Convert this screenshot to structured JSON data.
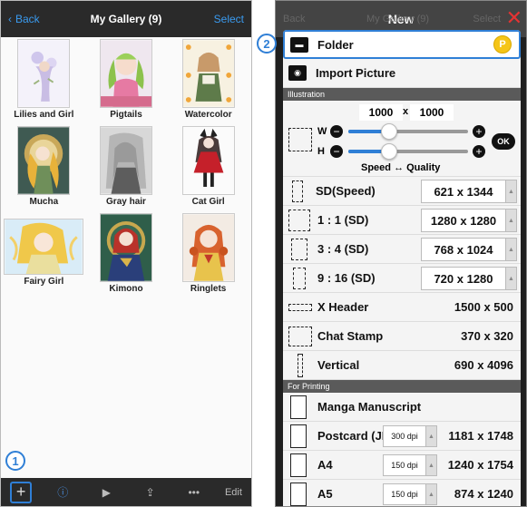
{
  "left": {
    "nav": {
      "back": "Back",
      "title": "My Gallery (9)",
      "select": "Select"
    },
    "items": [
      {
        "caption": "Lilies and Girl"
      },
      {
        "caption": "Pigtails"
      },
      {
        "caption": "Watercolor"
      },
      {
        "caption": "Mucha"
      },
      {
        "caption": "Gray hair"
      },
      {
        "caption": "Cat Girl"
      },
      {
        "caption": "Fairy Girl"
      },
      {
        "caption": "Kimono"
      },
      {
        "caption": "Ringlets"
      }
    ],
    "toolbar": {
      "plus": "+",
      "info": "ⓘ",
      "play": "▶",
      "share": "⇪",
      "more": "•••",
      "edit": "Edit"
    },
    "step_badge": "1"
  },
  "right": {
    "nav": {
      "ghost_back": "Back",
      "ghost_title": "My Gallery (9)",
      "ghost_select": "Select",
      "title": "New",
      "close": "✕"
    },
    "step_badge": "2",
    "folder": {
      "label": "Folder",
      "coin": "P"
    },
    "import": {
      "label": "Import Picture"
    },
    "section_illustration": "Illustration",
    "custom": {
      "width": "1000",
      "x": "x",
      "height": "1000",
      "w_label": "W",
      "h_label": "H",
      "ok": "OK",
      "quality": "Speed ↔ Quality",
      "minus": "−",
      "plus": "+"
    },
    "presets": [
      {
        "label": "SD(Speed)",
        "value": "621 x 1344",
        "boxed": true
      },
      {
        "label": "1 : 1 (SD)",
        "value": "1280 x 1280",
        "boxed": true
      },
      {
        "label": "3 : 4 (SD)",
        "value": "768 x 1024",
        "boxed": true
      },
      {
        "label": "9 : 16 (SD)",
        "value": "720 x 1280",
        "boxed": true
      },
      {
        "label": "X Header",
        "value": "1500 x 500",
        "boxed": false
      },
      {
        "label": "Chat Stamp",
        "value": "370 x 320",
        "boxed": false
      },
      {
        "label": "Vertical",
        "value": "690 x 4096",
        "boxed": false
      }
    ],
    "section_printing": "For Printing",
    "printing": [
      {
        "label": "Manga Manuscript",
        "dpi": "",
        "value": ""
      },
      {
        "label": "Postcard (JP)",
        "dpi": "300 dpi",
        "value": "1181 x 1748"
      },
      {
        "label": "A4",
        "dpi": "150 dpi",
        "value": "1240 x 1754"
      },
      {
        "label": "A5",
        "dpi": "150 dpi",
        "value": "874 x 1240"
      }
    ],
    "accent_color": "#2f7fd6"
  }
}
